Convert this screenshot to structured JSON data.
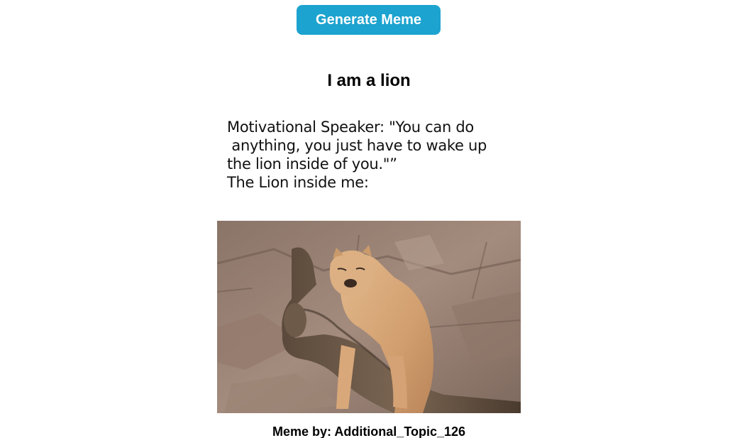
{
  "controls": {
    "generate_label": "Generate Meme"
  },
  "meme": {
    "title": "I am a lion",
    "caption_lines": [
      "Motivational Speaker: \"You can do",
      " anything, you just have to wake up",
      "the lion inside of you.\"”",
      "",
      "The Lion inside me:"
    ],
    "image_subject": "lioness sleeping on a tree branch"
  },
  "credit": {
    "text": "Meme by: Additional_Topic_126"
  }
}
